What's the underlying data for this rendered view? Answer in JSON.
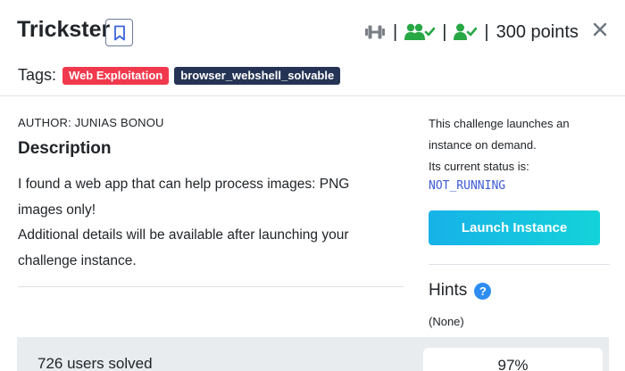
{
  "challenge": {
    "title": "Trickster",
    "points": "300 points"
  },
  "tags": {
    "label": "Tags:",
    "items": [
      {
        "text": "Web Exploitation",
        "color": "#f1394d"
      },
      {
        "text": "browser_webshell_solvable",
        "color": "#253454"
      }
    ]
  },
  "author": "AUTHOR: JUNIAS BONOU",
  "description": {
    "heading": "Description",
    "line1": "I found a web app that can help process images: PNG images only!",
    "line2": "Additional details will be available after launching your challenge instance."
  },
  "instance": {
    "line1": "This challenge launches an",
    "line2": "instance on demand.",
    "line3": "Its current status is:",
    "status": "NOT_RUNNING",
    "button": "Launch Instance"
  },
  "hints": {
    "heading": "Hints",
    "help_icon": "?",
    "value": "(None)"
  },
  "stats": {
    "solved": "726 users solved",
    "percent": "97%"
  },
  "colors": {
    "accent_green": "#28a745",
    "status_blue": "#3d5bd6",
    "launch_gradient_start": "#17b2e8",
    "launch_gradient_end": "#14d3d9"
  },
  "icons": {
    "bookmark": "bookmark-icon",
    "difficulty": "dumbbell-icon",
    "solved_by_users": "users-check-icon",
    "solved_by_me": "user-check-icon",
    "close": "close-icon"
  }
}
